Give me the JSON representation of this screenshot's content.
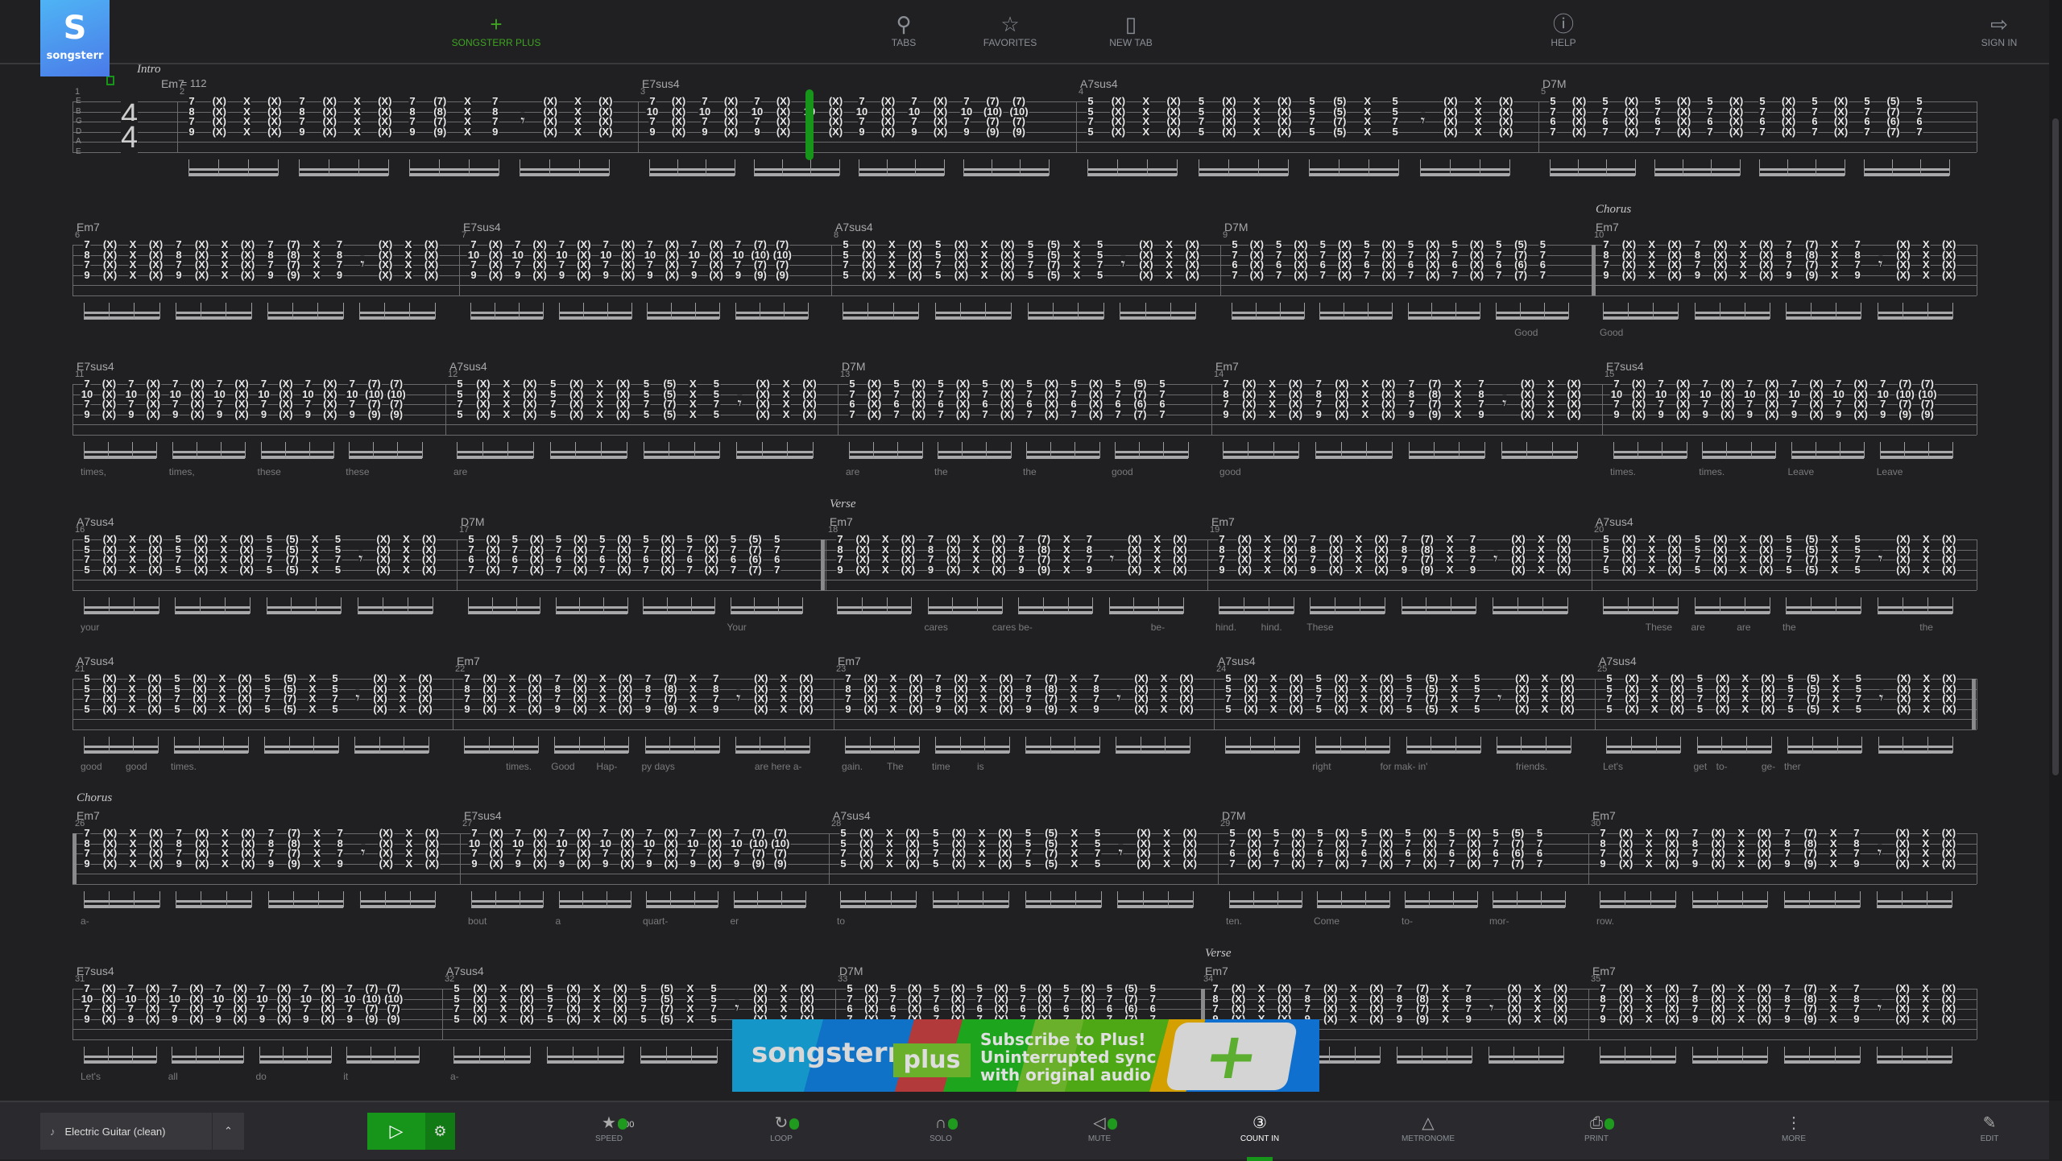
{
  "header": {
    "logo_text": "songsterr",
    "nav": [
      {
        "id": "songsterr-plus",
        "label": "SONGSTERR PLUS",
        "icon": "plus-icon"
      },
      {
        "id": "tabs",
        "label": "TABS",
        "icon": "search-icon"
      },
      {
        "id": "favorites",
        "label": "FAVORITES",
        "icon": "star-icon"
      },
      {
        "id": "new-tab",
        "label": "NEW TAB",
        "icon": "new-document-icon"
      },
      {
        "id": "help",
        "label": "HELP",
        "icon": "help-icon"
      },
      {
        "id": "sign-in",
        "label": "SIGN IN",
        "icon": "sign-in-icon"
      }
    ]
  },
  "score": {
    "tempo": "= 112",
    "time_signature": [
      "4",
      "4"
    ],
    "tuning": [
      "E",
      "B",
      "G",
      "D",
      "A",
      "E"
    ],
    "chords": {
      "Em7": [
        "7",
        "8",
        "7",
        "9"
      ],
      "E7sus4": [
        "7",
        "10",
        "7",
        "9"
      ],
      "A7sus4": [
        "5",
        "5",
        "7",
        "5"
      ],
      "D7M": [
        "5",
        "7",
        "6",
        "7"
      ]
    },
    "patterns": {
      "Em7": [
        "c",
        "(X)",
        "X",
        "(X)",
        "c",
        "(X)",
        "X",
        "(X)",
        "c",
        "(c)",
        "X",
        "c",
        "r",
        "(X)",
        "X",
        "(X)"
      ],
      "A7sus4": [
        "c",
        "(X)",
        "X",
        "(X)",
        "c",
        "(X)",
        "X",
        "(X)",
        "c",
        "(c)",
        "X",
        "c",
        "r",
        "(X)",
        "X",
        "(X)"
      ],
      "E7sus4": [
        "c",
        "(X)",
        "c",
        "(X)",
        "c",
        "(X)",
        "c",
        "(X)",
        "c",
        "(X)",
        "c",
        "(X)",
        "c",
        "(c)",
        "(c)"
      ],
      "D7M": [
        "c",
        "(X)",
        "c",
        "(X)",
        "c",
        "(X)",
        "c",
        "(X)",
        "c",
        "(X)",
        "c",
        "(X)",
        "c",
        "(c)",
        "c"
      ]
    },
    "playback_position": {
      "measure": 3,
      "beat_slot": 6
    },
    "rows": [
      [
        1,
        2,
        3,
        4,
        5
      ],
      [
        6,
        7,
        8,
        9,
        10
      ],
      [
        11,
        12,
        13,
        14,
        15
      ],
      [
        16,
        17,
        18,
        19,
        20
      ],
      [
        21,
        22,
        23,
        24,
        25
      ],
      [
        26,
        27,
        28,
        29,
        30
      ],
      [
        31,
        32,
        33,
        34,
        35
      ]
    ],
    "measures": {
      "1": {
        "chord": null
      },
      "2": {
        "chord": "Em7",
        "section": "Intro"
      },
      "3": {
        "chord": "E7sus4"
      },
      "4": {
        "chord": "A7sus4"
      },
      "5": {
        "chord": "D7M"
      },
      "6": {
        "chord": "Em7"
      },
      "7": {
        "chord": "E7sus4"
      },
      "8": {
        "chord": "A7sus4"
      },
      "9": {
        "chord": "D7M",
        "lyrics": [
          [
            13,
            "Good"
          ]
        ]
      },
      "10": {
        "chord": "Em7",
        "section": "Chorus",
        "repeat_start": true,
        "lyrics": [
          [
            0,
            "Good"
          ]
        ]
      },
      "11": {
        "chord": "E7sus4",
        "lyrics": [
          [
            0,
            "times,"
          ],
          [
            4,
            "times,"
          ],
          [
            8,
            "these"
          ],
          [
            12,
            "these"
          ]
        ]
      },
      "12": {
        "chord": "A7sus4",
        "lyrics": [
          [
            0,
            "are"
          ]
        ]
      },
      "13": {
        "chord": "D7M",
        "lyrics": [
          [
            0,
            "are"
          ],
          [
            4,
            "the"
          ],
          [
            8,
            "the"
          ],
          [
            12,
            "good"
          ]
        ]
      },
      "14": {
        "chord": "Em7",
        "lyrics": [
          [
            0,
            "good"
          ]
        ]
      },
      "15": {
        "chord": "E7sus4",
        "lyrics": [
          [
            0,
            "times."
          ],
          [
            4,
            "times."
          ],
          [
            8,
            "Leave"
          ],
          [
            12,
            "Leave"
          ]
        ]
      },
      "16": {
        "chord": "A7sus4",
        "lyrics": [
          [
            0,
            "your"
          ]
        ]
      },
      "17": {
        "chord": "D7M",
        "repeat_end": true,
        "lyrics": [
          [
            12,
            "Your"
          ]
        ]
      },
      "18": {
        "chord": "Em7",
        "section": "Verse",
        "lyrics": [
          [
            4,
            "cares"
          ],
          [
            7,
            "cares be-"
          ],
          [
            14,
            "be-"
          ]
        ]
      },
      "19": {
        "chord": "Em7",
        "lyrics": [
          [
            0,
            "hind."
          ],
          [
            2,
            "hind."
          ],
          [
            4,
            "These"
          ]
        ]
      },
      "20": {
        "chord": "A7sus4",
        "lyrics": [
          [
            2,
            "These"
          ],
          [
            4,
            "are"
          ],
          [
            6,
            "are"
          ],
          [
            8,
            "the"
          ],
          [
            14,
            "the"
          ]
        ]
      },
      "21": {
        "chord": "A7sus4",
        "lyrics": [
          [
            0,
            "good"
          ],
          [
            2,
            "good"
          ],
          [
            4,
            "times."
          ]
        ]
      },
      "22": {
        "chord": "Em7",
        "lyrics": [
          [
            2,
            "times."
          ],
          [
            4,
            "Good"
          ],
          [
            6,
            "Hap-"
          ],
          [
            8,
            "py days"
          ],
          [
            13,
            "are here  a-"
          ]
        ]
      },
      "23": {
        "chord": "Em7",
        "lyrics": [
          [
            0,
            "gain."
          ],
          [
            2,
            "The"
          ],
          [
            4,
            "time"
          ],
          [
            6,
            "is"
          ]
        ]
      },
      "24": {
        "chord": "A7sus4",
        "lyrics": [
          [
            4,
            "right"
          ],
          [
            7,
            "for mak- in'"
          ],
          [
            13,
            "friends."
          ]
        ]
      },
      "25": {
        "chord": "A7sus4",
        "repeat_end": true,
        "lyrics": [
          [
            0,
            "Let's"
          ],
          [
            4,
            "get"
          ],
          [
            5,
            "to-"
          ],
          [
            7,
            "ge-"
          ],
          [
            8,
            "ther"
          ]
        ]
      },
      "26": {
        "chord": "Em7",
        "section": "Chorus",
        "repeat_start": true,
        "lyrics": [
          [
            0,
            "a-"
          ]
        ]
      },
      "27": {
        "chord": "E7sus4",
        "lyrics": [
          [
            0,
            "bout"
          ],
          [
            4,
            "a"
          ],
          [
            8,
            "quart-"
          ],
          [
            12,
            "er"
          ]
        ]
      },
      "28": {
        "chord": "A7sus4",
        "lyrics": [
          [
            0,
            "to"
          ]
        ]
      },
      "29": {
        "chord": "D7M",
        "lyrics": [
          [
            0,
            "ten."
          ],
          [
            4,
            "Come"
          ],
          [
            8,
            "to-"
          ],
          [
            12,
            "mor-"
          ]
        ]
      },
      "30": {
        "chord": "Em7",
        "lyrics": [
          [
            0,
            "row."
          ]
        ]
      },
      "31": {
        "chord": "E7sus4",
        "lyrics": [
          [
            0,
            "Let's"
          ],
          [
            4,
            "all"
          ],
          [
            8,
            "do"
          ],
          [
            12,
            "it"
          ]
        ]
      },
      "32": {
        "chord": "A7sus4",
        "lyrics": [
          [
            0,
            "a-"
          ]
        ]
      },
      "33": {
        "chord": "D7M"
      },
      "34": {
        "chord": "Em7",
        "section": "Verse",
        "repeat_start": true
      },
      "35": {
        "chord": "Em7"
      }
    }
  },
  "banner": {
    "logo": "songsterr",
    "plus": "plus",
    "lines": [
      "Subscribe to Plus!",
      "Uninterrupted sync",
      "with original audio"
    ]
  },
  "player": {
    "instrument": "Electric Guitar (clean)",
    "speed_value": "100",
    "controls": [
      {
        "id": "speed",
        "label": "SPEED",
        "icon": "speed-icon",
        "locked": true
      },
      {
        "id": "loop",
        "label": "LOOP",
        "icon": "loop-icon",
        "locked": true
      },
      {
        "id": "solo",
        "label": "SOLO",
        "icon": "headphones-icon",
        "locked": true
      },
      {
        "id": "mute",
        "label": "MUTE",
        "icon": "speaker-mute-icon",
        "locked": true
      },
      {
        "id": "count-in",
        "label": "COUNT IN",
        "icon": "count-in-icon",
        "active": true
      },
      {
        "id": "metronome",
        "label": "METRONOME",
        "icon": "metronome-icon"
      },
      {
        "id": "print",
        "label": "PRINT",
        "icon": "printer-icon",
        "locked": true
      },
      {
        "id": "more",
        "label": "MORE",
        "icon": "more-vertical-icon"
      },
      {
        "id": "edit",
        "label": "EDIT",
        "icon": "pencil-icon"
      }
    ]
  },
  "colors": {
    "accent": "#17941a",
    "background": "#202022",
    "toolbar": "#2a2a2e"
  }
}
